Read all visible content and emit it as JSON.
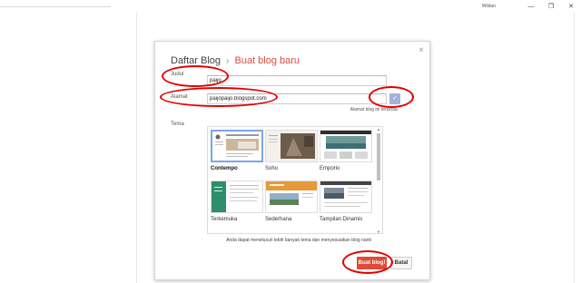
{
  "window": {
    "user": "Wildan",
    "minimize": "—",
    "restore": "❐",
    "close": "✕"
  },
  "dialog": {
    "title_main": "Daftar Blog",
    "title_sep": "›",
    "title_sub": "Buat blog baru",
    "close": "×",
    "judul_label": "Judul",
    "judul_value": "paijo",
    "alamat_label": "Alamat",
    "alamat_value": "paijopaijo.blogspot.com",
    "check_mark": "✓",
    "alamat_hint": "Alamat blog ini tersedia.",
    "tema_label": "Tema",
    "themes": [
      {
        "name": "Contempo",
        "selected": true
      },
      {
        "name": "Soho",
        "selected": false
      },
      {
        "name": "Emporio",
        "selected": false
      },
      {
        "name": "Terkemuka",
        "selected": false
      },
      {
        "name": "Sederhana",
        "selected": false
      },
      {
        "name": "Tampilan Dinamis",
        "selected": false
      }
    ],
    "themes_more": "Anda dapat menelusuri lebih banyak tema dan menyesuaikan blog nanti",
    "create_button": "Buat blog!",
    "cancel_button": "Batal"
  },
  "colors": {
    "accent_red": "#dd4b39",
    "selection_blue": "#7aa7e9",
    "annotation_red": "#e00000"
  }
}
